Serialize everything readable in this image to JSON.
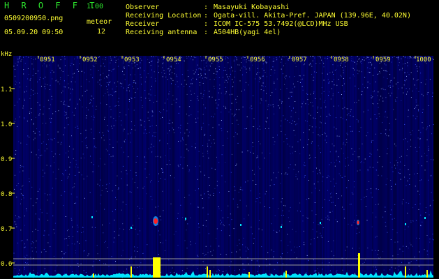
{
  "header": {
    "app_title": "H R O F F T",
    "app_version": "1.00",
    "file_name": "0509200950.png",
    "date_time": "05.09.20 09:50",
    "meteor_label": "meteor",
    "meteor_count": "12"
  },
  "info": [
    {
      "key": "Observer",
      "value": "Masayuki Kobayashi"
    },
    {
      "key": "Receiving Location",
      "value": "Ogata-vill. Akita-Pref. JAPAN (139.96E, 40.02N)"
    },
    {
      "key": "Receiver",
      "value": "ICOM IC-575 53.7492(@LCD)MHz USB"
    },
    {
      "key": "Receiving antenna",
      "value": "A504HB(yagi 4el)"
    }
  ],
  "spectrogram": {
    "y_unit": "kHz",
    "y_ticks": [
      "1.1",
      "1.0",
      "0.9",
      "0.8",
      "0.7",
      "0.6"
    ],
    "time_labels": [
      "0951",
      "0952",
      "0953",
      "0954",
      "0955",
      "0956",
      "0957",
      "0958",
      "0959",
      "1000"
    ],
    "colors": {
      "background": "#000000",
      "noise_dark": "#00008c",
      "noise_light": "#9bb3ff",
      "header_text": "#ffff33",
      "title": "#2ee82e",
      "trace": "#00e5ff",
      "spike": "#ffff00",
      "echo": "#ff2222"
    }
  }
}
